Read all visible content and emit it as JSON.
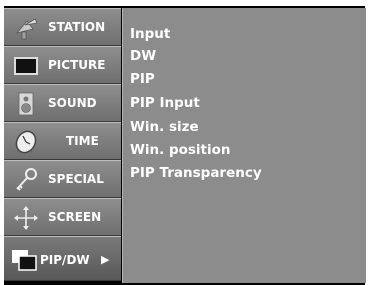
{
  "menu": {
    "items": [
      {
        "label": "STATION",
        "icon": "satellite-dish-icon"
      },
      {
        "label": "PICTURE",
        "icon": "tv-screen-icon"
      },
      {
        "label": "SOUND",
        "icon": "speaker-icon"
      },
      {
        "label": "TIME",
        "icon": "clock-icon"
      },
      {
        "label": "SPECIAL",
        "icon": "key-icon"
      },
      {
        "label": "SCREEN",
        "icon": "move-arrows-icon"
      },
      {
        "label": "PIP/DW",
        "icon": "pip-window-icon",
        "selected": true,
        "arrow": "▶"
      }
    ]
  },
  "submenu": {
    "options": [
      "Input",
      "DW",
      "PIP",
      "PIP Input",
      "Win. size",
      "Win. position",
      "PIP Transparency"
    ]
  }
}
